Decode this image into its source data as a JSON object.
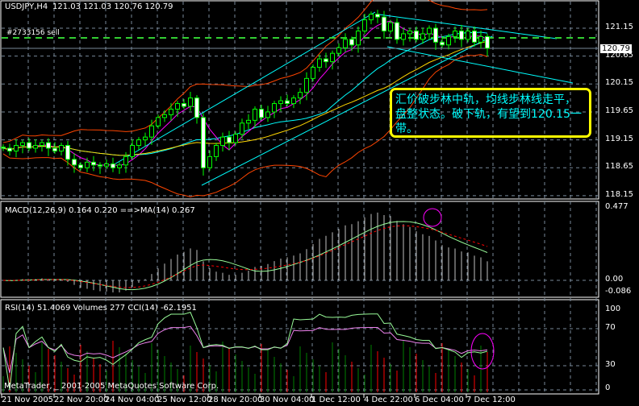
{
  "header": {
    "symbol": "USDJPY,H4",
    "ohlc": "121.03 121.03 120.76 120.79",
    "order_label": "#2733156 sell"
  },
  "copyright": "MetaTrader, _ 2001-2005 MetaQuotes Software Corp.",
  "annotation": "汇价破步林中轨，均线步林线走平，盘整状态。破下轨，有望到120.15一带。",
  "chart_data": [
    {
      "type": "candlestick",
      "title": "USDJPY,H4",
      "ylim": [
        118.15,
        121.45
      ],
      "yticks": [
        "121.15",
        "120.65",
        "120.15",
        "119.65",
        "119.15",
        "118.65",
        "118.15"
      ],
      "current_price": "120.79",
      "sell_level": 121.03,
      "close": [
        119.0,
        118.95,
        119.05,
        119.1,
        119.0,
        119.05,
        119.1,
        119.0,
        118.95,
        119.05,
        118.8,
        118.7,
        118.65,
        118.75,
        118.7,
        118.68,
        118.72,
        118.65,
        118.7,
        118.85,
        119.05,
        119.15,
        119.2,
        119.4,
        119.55,
        119.6,
        119.7,
        119.8,
        119.75,
        119.9,
        119.55,
        118.65,
        118.85,
        119.05,
        119.2,
        119.1,
        119.25,
        119.45,
        119.5,
        119.7,
        119.55,
        119.65,
        119.8,
        119.85,
        119.8,
        119.9,
        120.0,
        120.25,
        120.45,
        120.6,
        120.55,
        120.7,
        120.8,
        120.95,
        120.85,
        121.1,
        121.3,
        121.4,
        121.35,
        121.1,
        121.25,
        120.95,
        121.05,
        121.1,
        120.95,
        121.05,
        121.15,
        120.9,
        120.85,
        121.0,
        121.1,
        120.95,
        121.1,
        120.9,
        121.0,
        120.79
      ]
    },
    {
      "type": "line",
      "title": "MACD(12,26,9) 0.164 0.220  ==>MA(14) 0.267",
      "yticks": [
        "0.477",
        "0.00",
        "-0.086"
      ],
      "ylim": [
        -0.086,
        0.477
      ]
    },
    {
      "type": "line",
      "title": "RSI(14) 51.4069  Volumes 277  CCI(14) -62.1951",
      "yticks": [
        "100",
        "70",
        "30",
        "0"
      ],
      "ylim": [
        0,
        100
      ]
    }
  ],
  "xaxis": [
    "21 Nov 2005",
    "22 Nov 20:00",
    "24 Nov 04:00",
    "25 Nov 12:00",
    "28 Nov 20:00",
    "30 Nov 04:00",
    "1 Dec 12:00",
    "4 Dec 22:00",
    "6 Dec 04:00",
    "7 Dec 12:00"
  ],
  "colors": {
    "bull": "#000000",
    "bear": "#ffffff",
    "wick": "#00ff00",
    "sell": "#32cd32",
    "channel": "#00ffff",
    "boll": "#ff4500",
    "macd": "#98fb98",
    "signal": "#ff0000",
    "rsi": "#98fb98",
    "cci": "#ee82ee",
    "note": "#ffff00"
  }
}
